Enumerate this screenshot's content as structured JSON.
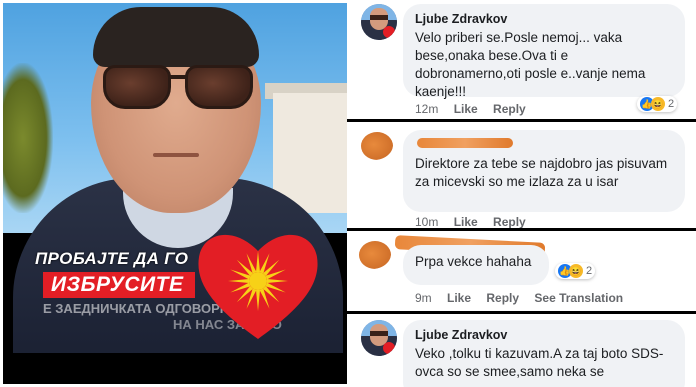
{
  "photo": {
    "banner_line1": "ПРОБАЈТЕ ДА ГО",
    "banner_line2": "ИЗБРУСИТЕ",
    "banner_sub1": "Е ЗАЕДНИЧКАТА ОДГОВОРНОСТ",
    "banner_sub2": "НА НАС ЗАЕДНО",
    "accent_red": "#e31e25",
    "sun_gold": "#f7d117"
  },
  "comments": [
    {
      "author": "Ljube Zdravkov",
      "text": "Velo priberi se.Posle nemoj... vaka bese,onaka bese.Ova ti e dobronamerno,oti posle e..vanje nema kaenje!!!",
      "time": "12m",
      "like": "Like",
      "reply": "Reply",
      "reaction_count": "2",
      "reactions": [
        "like-icon",
        "haha-icon"
      ]
    },
    {
      "author": "",
      "text": "Direktore za tebe se najdobro jas pisuvam za micevski so me izlaza za u isar",
      "time": "10m",
      "like": "Like",
      "reply": "Reply"
    },
    {
      "author": "",
      "text": "Prpa vekce hahaha",
      "time": "9m",
      "like": "Like",
      "reply": "Reply",
      "see_translation": "See Translation",
      "reaction_count": "2",
      "reactions": [
        "like-icon",
        "haha-icon"
      ]
    },
    {
      "author": "Ljube Zdravkov",
      "text": "Veko ,tolku ti kazuvam.A za taj boto SDS- ovca so se smee,samo neka se"
    }
  ]
}
